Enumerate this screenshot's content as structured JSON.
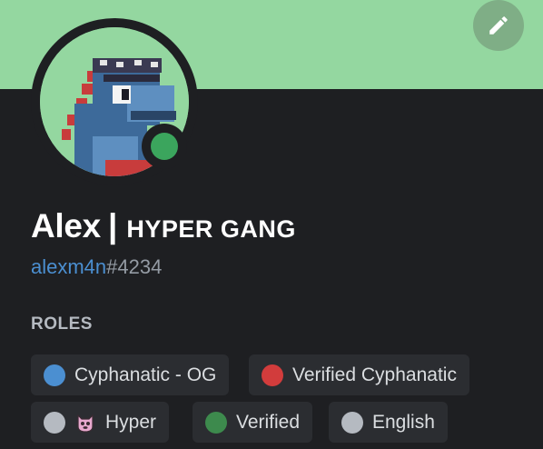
{
  "banner": {
    "color": "#94d7a0"
  },
  "profile": {
    "display_name": "Alex",
    "separator": "|",
    "tag_text": "HYPER GANG",
    "username": "alexm4n",
    "discriminator": "#4234",
    "status": "online",
    "status_color": "#3ba55d"
  },
  "actions": {
    "edit_icon": "pencil-icon"
  },
  "roles": {
    "title": "ROLES",
    "items": [
      {
        "label": "Cyphanatic - OG",
        "color": "#4b8fd1"
      },
      {
        "label": "Verified Cyphanatic",
        "color": "#d23c3c"
      },
      {
        "label": "Hyper",
        "color": "#b5bac1",
        "emoji": "devil-cat-emoji"
      },
      {
        "label": "Verified",
        "color": "#3d8a4d"
      },
      {
        "label": "English",
        "color": "#b5bac1"
      }
    ]
  }
}
